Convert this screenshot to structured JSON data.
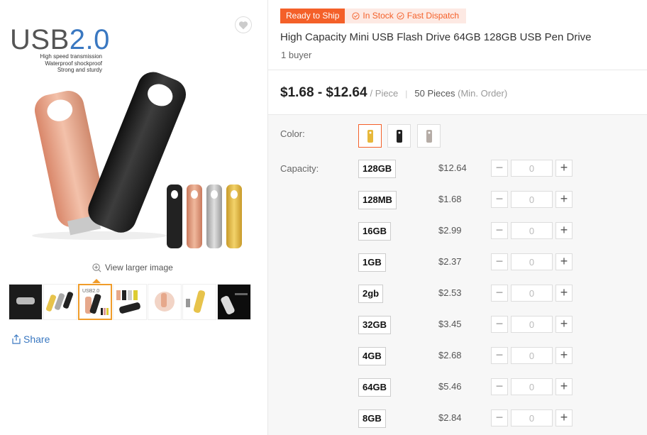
{
  "gallery": {
    "main_title_prefix": "USB",
    "main_title_version": "2.0",
    "tagline_lines": [
      "High speed transmission",
      "Waterproof shockproof",
      "Strong and sturdy"
    ],
    "view_larger": "View larger image",
    "share": "Share"
  },
  "product": {
    "badge_ready": "Ready to Ship",
    "badge_stock": "In Stock",
    "badge_dispatch": "Fast Dispatch",
    "title": "High Capacity Mini USB Flash Drive 64GB 128GB USB Pen Drive",
    "buyers": "1 buyer",
    "price_range": "$1.68 - $12.64",
    "price_unit": "/ Piece",
    "moq": "50 Pieces",
    "moq_note": "(Min. Order)"
  },
  "options": {
    "color_label": "Color:",
    "capacity_label": "Capacity:",
    "colors": [
      "gold",
      "black",
      "silver"
    ],
    "capacities": [
      {
        "label": "128GB",
        "price": "$12.64",
        "qty": "0"
      },
      {
        "label": "128MB",
        "price": "$1.68",
        "qty": "0"
      },
      {
        "label": "16GB",
        "price": "$2.99",
        "qty": "0"
      },
      {
        "label": "1GB",
        "price": "$2.37",
        "qty": "0"
      },
      {
        "label": "2gb",
        "price": "$2.53",
        "qty": "0"
      },
      {
        "label": "32GB",
        "price": "$3.45",
        "qty": "0"
      },
      {
        "label": "4GB",
        "price": "$2.68",
        "qty": "0"
      },
      {
        "label": "64GB",
        "price": "$5.46",
        "qty": "0"
      },
      {
        "label": "8GB",
        "price": "$2.84",
        "qty": "0"
      }
    ]
  },
  "colors": {
    "accent": "#f46029",
    "link": "#3a78c1",
    "thumb_active": "#f09c2a"
  }
}
